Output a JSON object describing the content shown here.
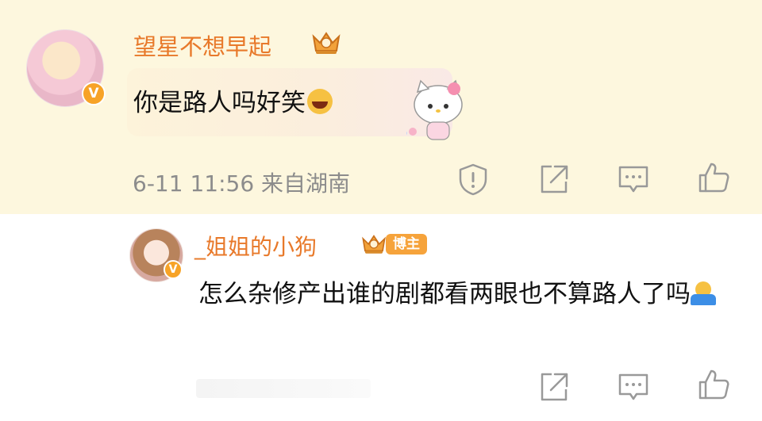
{
  "comment": {
    "username": "望星不想早起",
    "text": "你是路人吗好笑",
    "emoji": "laughing-tears-emoji",
    "meta": "6-11 11:56 来自湖南",
    "actions": [
      "report-icon",
      "share-icon",
      "comment-icon",
      "like-icon"
    ],
    "colors": {
      "highlight_bg": "#fdf7de",
      "username": "#e8792a",
      "verified_badge": "#f7a327"
    }
  },
  "reply": {
    "username": "_姐姐的小狗",
    "badge": "博主",
    "text": "怎么杂修产出谁的剧都看两眼也不算路人了吗",
    "emoji": "shrug-emoji",
    "actions": [
      "share-icon",
      "comment-icon",
      "like-icon"
    ],
    "colors": {
      "badge_bg": "#f6a33b"
    }
  }
}
